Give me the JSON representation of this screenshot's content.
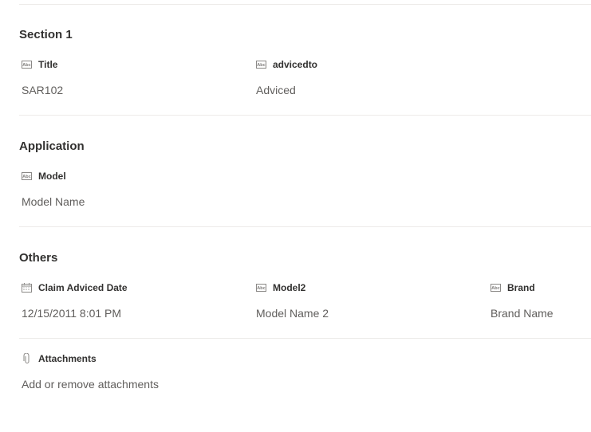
{
  "sections": [
    {
      "title": "Section 1",
      "fields": [
        {
          "label": "Title",
          "value": "SAR102",
          "icon": "text-field-icon"
        },
        {
          "label": "advicedto",
          "value": "Adviced",
          "icon": "text-field-icon"
        }
      ]
    },
    {
      "title": "Application",
      "fields": [
        {
          "label": "Model",
          "value": "Model Name",
          "icon": "text-field-icon"
        }
      ]
    },
    {
      "title": "Others",
      "fields": [
        {
          "label": "Claim Adviced Date",
          "value": "12/15/2011 8:01 PM",
          "icon": "calendar-icon"
        },
        {
          "label": "Model2",
          "value": "Model Name 2",
          "icon": "text-field-icon"
        },
        {
          "label": "Brand",
          "value": "Brand Name",
          "icon": "text-field-icon"
        }
      ]
    }
  ],
  "attachments": {
    "label": "Attachments",
    "action": "Add or remove attachments",
    "icon": "paperclip-icon"
  },
  "colors": {
    "text_primary": "#323130",
    "text_secondary": "#605e5c",
    "divider": "#edebe9",
    "icon": "#8a8886"
  }
}
